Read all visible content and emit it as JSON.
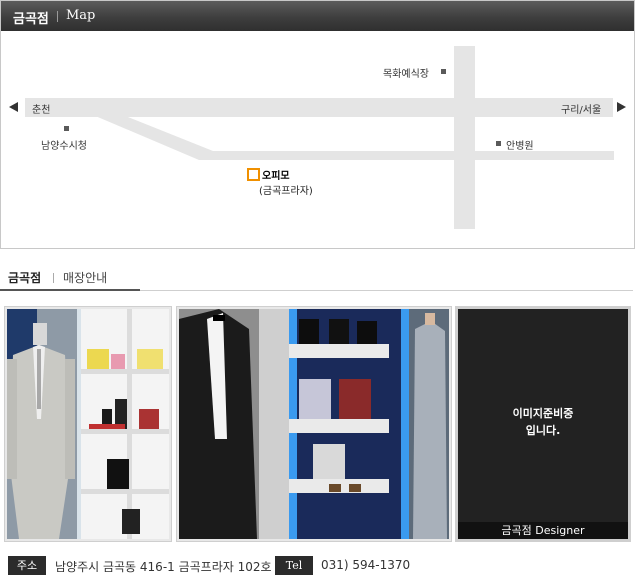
{
  "map": {
    "title": "금곡점",
    "subtitle": "Map",
    "labels": {
      "left_city": "춘천",
      "right_city": "구리/서울",
      "wedding_hall": "목화예식장",
      "city_hall": "남양수시청",
      "clinic": "안병원"
    },
    "marker": {
      "name": "오피모",
      "building": "(금곡프라자)",
      "accent_color": "#f09000"
    }
  },
  "store": {
    "tab_title": "금곡점",
    "tab_subtitle": "매장안내",
    "placeholder_message_line1": "이미지준비중",
    "placeholder_message_line2": "입니다.",
    "placeholder_caption": "금곡점 Designer"
  },
  "footer": {
    "address_label": "주소",
    "address": "남양주시 금곡동 416-1 금곡프라자 102호",
    "tel_label": "Tel",
    "tel": "031) 594-1370"
  },
  "icons": {
    "left_arrow": "left-arrow-icon",
    "right_arrow": "right-arrow-icon"
  }
}
